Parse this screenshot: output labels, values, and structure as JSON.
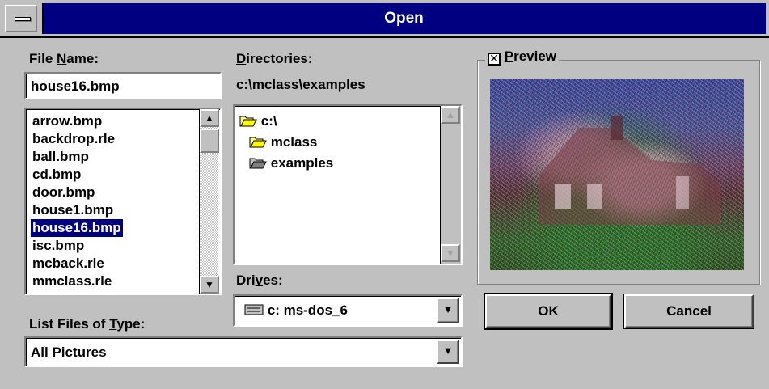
{
  "window": {
    "title": "Open"
  },
  "file_name": {
    "label_pre": "File ",
    "label_key": "N",
    "label_post": "ame:",
    "value": "house16.bmp",
    "files": [
      "arrow.bmp",
      "backdrop.rle",
      "ball.bmp",
      "cd.bmp",
      "door.bmp",
      "house1.bmp",
      "house16.bmp",
      "isc.bmp",
      "mcback.rle",
      "mmclass.rle"
    ],
    "selected_index": 6
  },
  "directories": {
    "label_pre": "",
    "label_key": "D",
    "label_post": "irectories:",
    "current_path": "c:\\mclass\\examples",
    "items": [
      "c:\\",
      "mclass",
      "examples"
    ]
  },
  "drives": {
    "label_pre": "Dri",
    "label_key": "v",
    "label_post": "es:",
    "selected": "c: ms-dos_6"
  },
  "file_type": {
    "label_pre": "List Files of ",
    "label_key": "T",
    "label_post": "ype:",
    "selected": "All Pictures"
  },
  "preview": {
    "checked": true,
    "label_pre": "",
    "label_key": "P",
    "label_post": "review"
  },
  "buttons": {
    "ok": "OK",
    "cancel": "Cancel"
  },
  "icons": {
    "system_menu": "minus-bar-icon",
    "scroll_up": "arrow-up-icon",
    "scroll_down": "arrow-down-icon",
    "dropdown": "dropdown-arrow-icon",
    "folder_open": "open-folder-icon",
    "folder_current": "current-folder-icon",
    "drive": "hard-drive-icon"
  }
}
